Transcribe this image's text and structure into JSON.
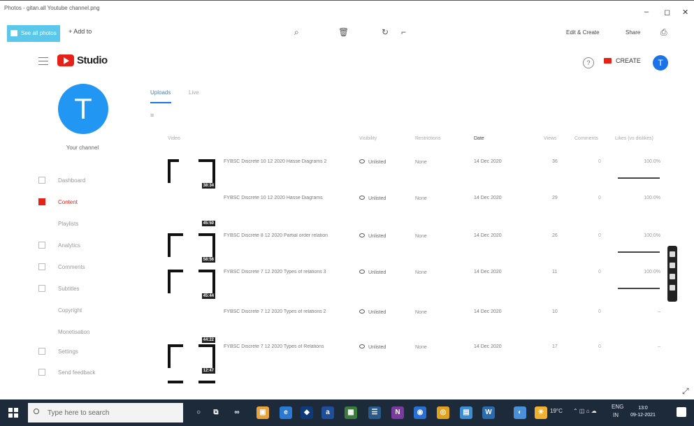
{
  "window": {
    "title": "Photos - gitan.all Youtube channel.png",
    "minimize": "–",
    "maximize": "◻",
    "close": "✕"
  },
  "toolbar": {
    "see_all": "See all photos",
    "add_to": "+ Add to",
    "edit_create": "Edit & Create",
    "share": "Share",
    "icons": [
      "zoom-icon",
      "delete-icon",
      "rotate-icon",
      "crop-icon",
      "print-icon"
    ]
  },
  "studio": {
    "brand": "Studio",
    "help": "?",
    "create_label": "CREATE",
    "avatar_letter": "T",
    "accent_color": "#e62117",
    "avatar_color": "#1a73e8"
  },
  "sidebar": {
    "avatar_letter": "T",
    "your_channel": "Your channel",
    "items": [
      {
        "label": "Dashboard",
        "active": false
      },
      {
        "label": "Content",
        "active": true
      },
      {
        "label": "Playlists",
        "active": false
      },
      {
        "label": "Analytics",
        "active": false
      },
      {
        "label": "Comments",
        "active": false
      },
      {
        "label": "Subtitles",
        "active": false
      },
      {
        "label": "Copyright",
        "active": false
      },
      {
        "label": "Monetisation",
        "active": false
      },
      {
        "label": "Settings",
        "active": false
      },
      {
        "label": "Send feedback",
        "active": false
      }
    ]
  },
  "content": {
    "tab_active": "Uploads",
    "tab_second": "Live",
    "columns": {
      "video": "Video",
      "visibility": "Visibility",
      "restrictions": "Restrictions",
      "date": "Date",
      "views": "Views",
      "comments": "Comments",
      "likes": "Likes (vs dislikes)"
    },
    "rows": [
      {
        "title": "FYBSC Discrete 10 12 2020 Hasse Diagrams 2",
        "duration": "38:34",
        "visibility": "Unlisted",
        "restrictions": "None",
        "date": "14 Dec 2020",
        "views": "36",
        "comments": "0",
        "likes": "100.0%"
      },
      {
        "title": "FYBSC Discrete 10 12 2020 Hasse Diagrams",
        "duration": "45:50",
        "visibility": "Unlisted",
        "restrictions": "None",
        "date": "14 Dec 2020",
        "views": "29",
        "comments": "0",
        "likes": "100.0%"
      },
      {
        "title": "FYBSC Discrete 8 12 2020 Partial order relation",
        "duration": "58:56",
        "visibility": "Unlisted",
        "restrictions": "None",
        "date": "14 Dec 2020",
        "views": "26",
        "comments": "0",
        "likes": "100.0%"
      },
      {
        "title": "FYBSC Discrete 7 12 2020 Types of relations 3",
        "duration": "45:44",
        "visibility": "Unlisted",
        "restrictions": "None",
        "date": "14 Dec 2020",
        "views": "11",
        "comments": "0",
        "likes": "100.0%"
      },
      {
        "title": "FYBSC Discrete 7 12 2020 Types of relations 2",
        "duration": "44:22",
        "visibility": "Unlisted",
        "restrictions": "None",
        "date": "14 Dec 2020",
        "views": "10",
        "comments": "0",
        "likes": "–"
      },
      {
        "title": "FYBSC Discrete 7 12 2020 Types of Relations",
        "duration": "12:47",
        "visibility": "Unlisted",
        "restrictions": "None",
        "date": "14 Dec 2020",
        "views": "17",
        "comments": "0",
        "likes": "–"
      }
    ]
  },
  "taskbar": {
    "search_placeholder": "Type here to search",
    "weather": "19°C",
    "lang": "ENG",
    "region": "IN",
    "time": "13:0",
    "date": "09-12-2021"
  }
}
